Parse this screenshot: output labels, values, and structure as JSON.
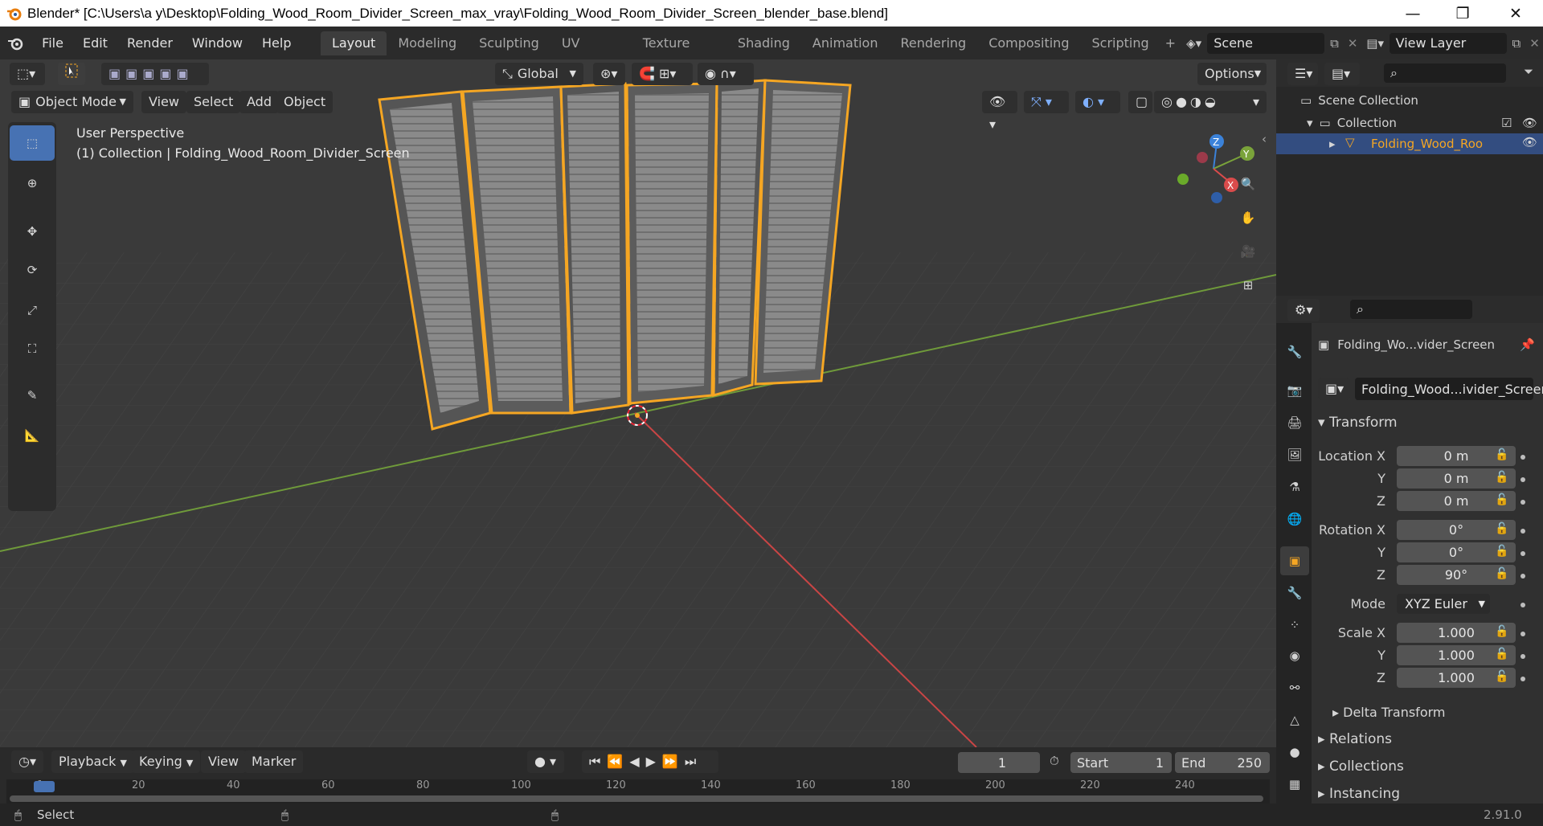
{
  "window": {
    "title": "Blender* [C:\\Users\\a y\\Desktop\\Folding_Wood_Room_Divider_Screen_max_vray\\Folding_Wood_Room_Divider_Screen_blender_base.blend]",
    "controls": {
      "minimize": "—",
      "maximize": "❐",
      "close": "✕"
    }
  },
  "menubar": {
    "items": [
      "File",
      "Edit",
      "Render",
      "Window",
      "Help"
    ]
  },
  "workspaces": {
    "tabs": [
      "Layout",
      "Modeling",
      "Sculpting",
      "UV Editing",
      "Texture Paint",
      "Shading",
      "Animation",
      "Rendering",
      "Compositing",
      "Scripting"
    ],
    "active": "Layout",
    "add": "+"
  },
  "scene": {
    "name": "Scene"
  },
  "view_layer": {
    "name": "View Layer"
  },
  "viewport": {
    "transform_orientation": "Global",
    "options_label": "Options",
    "mode": "Object Mode",
    "header_menus": [
      "View",
      "Select",
      "Add",
      "Object"
    ],
    "overlay_text": {
      "perspective": "User Perspective",
      "collection": "(1) Collection | Folding_Wood_Room_Divider_Screen"
    },
    "gizmo": {
      "x": "X",
      "y": "Y",
      "z": "Z"
    }
  },
  "outliner": {
    "scene_collection": "Scene Collection",
    "collection": "Collection",
    "object": "Folding_Wood_Room"
  },
  "properties": {
    "object_name": "Folding_Wo...vider_Screen",
    "datablock_name": "Folding_Wood...ivider_Screen",
    "transform_header": "Transform",
    "location": {
      "label": "Location X",
      "x": "0 m",
      "y": "0 m",
      "z": "0 m"
    },
    "rotation": {
      "label": "Rotation X",
      "x": "0°",
      "y": "0°",
      "z": "90°"
    },
    "mode": {
      "label": "Mode",
      "value": "XYZ Euler"
    },
    "scale": {
      "label": "Scale X",
      "x": "1.000",
      "y": "1.000",
      "z": "1.000"
    },
    "axis_labels": {
      "y": "Y",
      "z": "Z"
    },
    "sections": [
      "Delta Transform",
      "Relations",
      "Collections",
      "Instancing"
    ]
  },
  "timeline": {
    "menus": [
      "Playback",
      "Keying",
      "View",
      "Marker"
    ],
    "current_frame": "1",
    "start_label": "Start",
    "start": "1",
    "end_label": "End",
    "end": "250",
    "ruler": [
      "1",
      "20",
      "40",
      "60",
      "80",
      "100",
      "120",
      "140",
      "160",
      "180",
      "200",
      "220",
      "240"
    ]
  },
  "statusbar": {
    "action": "Select",
    "version": "2.91.0"
  },
  "colors": {
    "accent": "#4772b3",
    "selection_outline": "#f5a623",
    "axis_x": "#d94b4b",
    "axis_y": "#7aa33a",
    "axis_z": "#3b82d9"
  }
}
